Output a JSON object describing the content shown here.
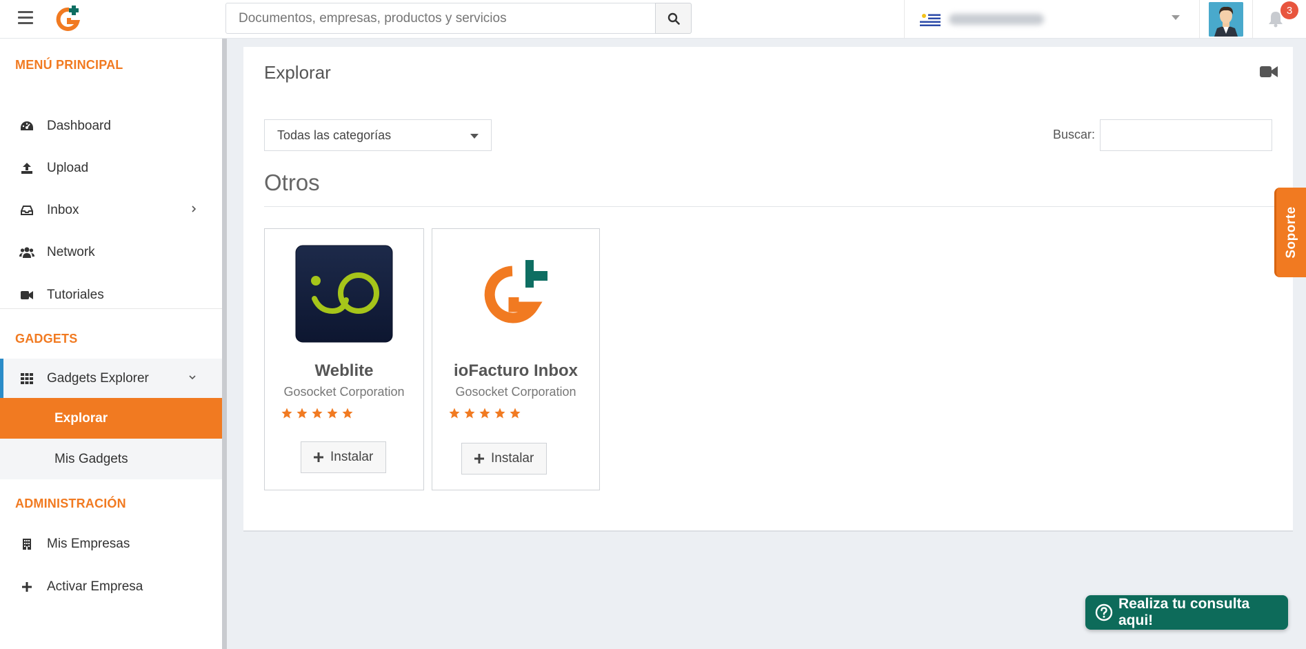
{
  "header": {
    "search_placeholder": "Documentos, empresas, productos y servicios",
    "notification_count": "3"
  },
  "sidebar": {
    "menu_title": "MENÚ PRINCIPAL",
    "main_items": [
      {
        "label": "Dashboard",
        "icon": "dashboard-icon"
      },
      {
        "label": "Upload",
        "icon": "upload-icon"
      },
      {
        "label": "Inbox",
        "icon": "inbox-icon"
      },
      {
        "label": "Network",
        "icon": "network-icon"
      },
      {
        "label": "Tutoriales",
        "icon": "video-icon"
      }
    ],
    "gadgets_title": "GADGETS",
    "gadgets_explorer": "Gadgets Explorer",
    "sub_items": [
      "Explorar",
      "Mis Gadgets"
    ],
    "admin_title": "ADMINISTRACIÓN",
    "admin_items": [
      {
        "label": "Mis Empresas",
        "icon": "building-icon"
      },
      {
        "label": "Activar Empresa",
        "icon": "plus-icon"
      }
    ]
  },
  "main": {
    "title": "Explorar",
    "category_select": "Todas las categorías",
    "search_label": "Buscar:",
    "section": "Otros",
    "cards": [
      {
        "name": "Weblite",
        "vendor": "Gosocket Corporation",
        "rating": 5,
        "install": "Instalar"
      },
      {
        "name": "ioFacturo Inbox",
        "vendor": "Gosocket Corporation",
        "rating": 5,
        "install": "Instalar"
      }
    ]
  },
  "soporte": "Soporte",
  "consulta": "Realiza tu consulta aqui!",
  "colors": {
    "accent": "#f17a21",
    "active_bar": "#2b8cc8",
    "chat_button": "#0d6b5a",
    "logo_teal": "#0e6e62"
  }
}
